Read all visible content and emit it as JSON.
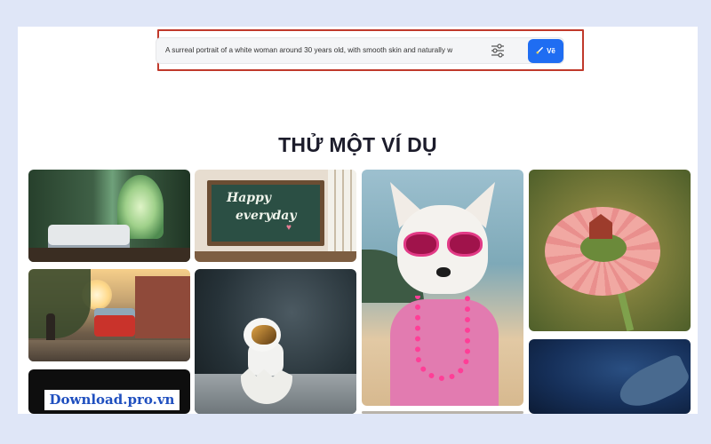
{
  "prompt": {
    "text": "A surreal portrait of a white woman around 30 years old, with smooth skin and naturally w",
    "settings_icon": "sliders-icon",
    "draw_button": {
      "label": "Vẽ",
      "icon": "brush-icon",
      "color": "#1f6df2"
    }
  },
  "highlight_color": "#c0392b",
  "heading": "THỬ MỘT VÍ DỤ",
  "gallery": {
    "chalkboard_line1": "Happy",
    "chalkboard_line2": "everyday"
  },
  "watermark": "Download.pro.vn"
}
